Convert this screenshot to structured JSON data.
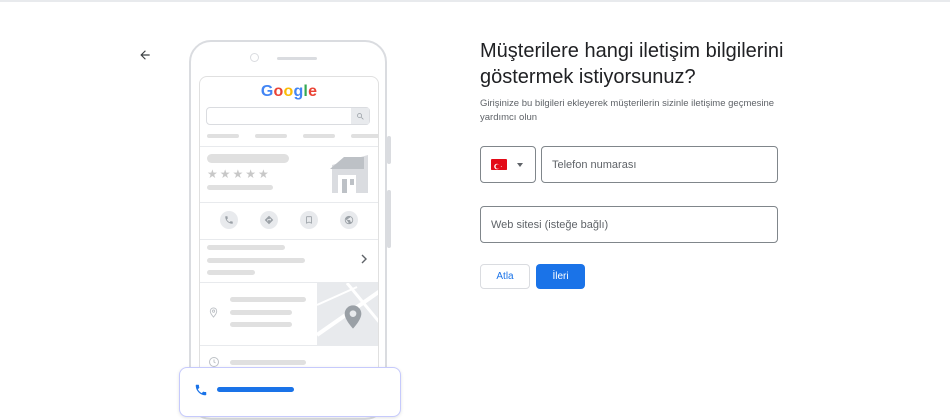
{
  "header": {
    "back_icon": "arrow-back-icon"
  },
  "illustration": {
    "logo_letters": [
      {
        "ch": "G",
        "color": "#4285f4"
      },
      {
        "ch": "o",
        "color": "#ea4335"
      },
      {
        "ch": "o",
        "color": "#fbbc05"
      },
      {
        "ch": "g",
        "color": "#4285f4"
      },
      {
        "ch": "l",
        "color": "#34a853"
      },
      {
        "ch": "e",
        "color": "#ea4335"
      }
    ],
    "stars": "★★★★★",
    "action_icons": [
      "phone-icon",
      "directions-icon",
      "bookmark-icon",
      "website-icon"
    ],
    "card_icon": "phone-icon"
  },
  "form": {
    "title": "Müşterilere hangi iletişim bilgilerini göstermek istiyorsunuz?",
    "subtitle": "Girişinize bu bilgileri ekleyerek müşterilerin sizinle iletişime geçmesine yardımcı olun",
    "country_flag": "flag-turkey-icon",
    "phone_placeholder": "Telefon numarası",
    "website_placeholder": "Web sitesi (isteğe bağlı)",
    "skip_label": "Atla",
    "next_label": "İleri"
  },
  "colors": {
    "accent": "#1a73e8",
    "field_border": "#80868b",
    "placeholder_bar": "#e0e0e0",
    "flag_red": "#e30a17"
  }
}
